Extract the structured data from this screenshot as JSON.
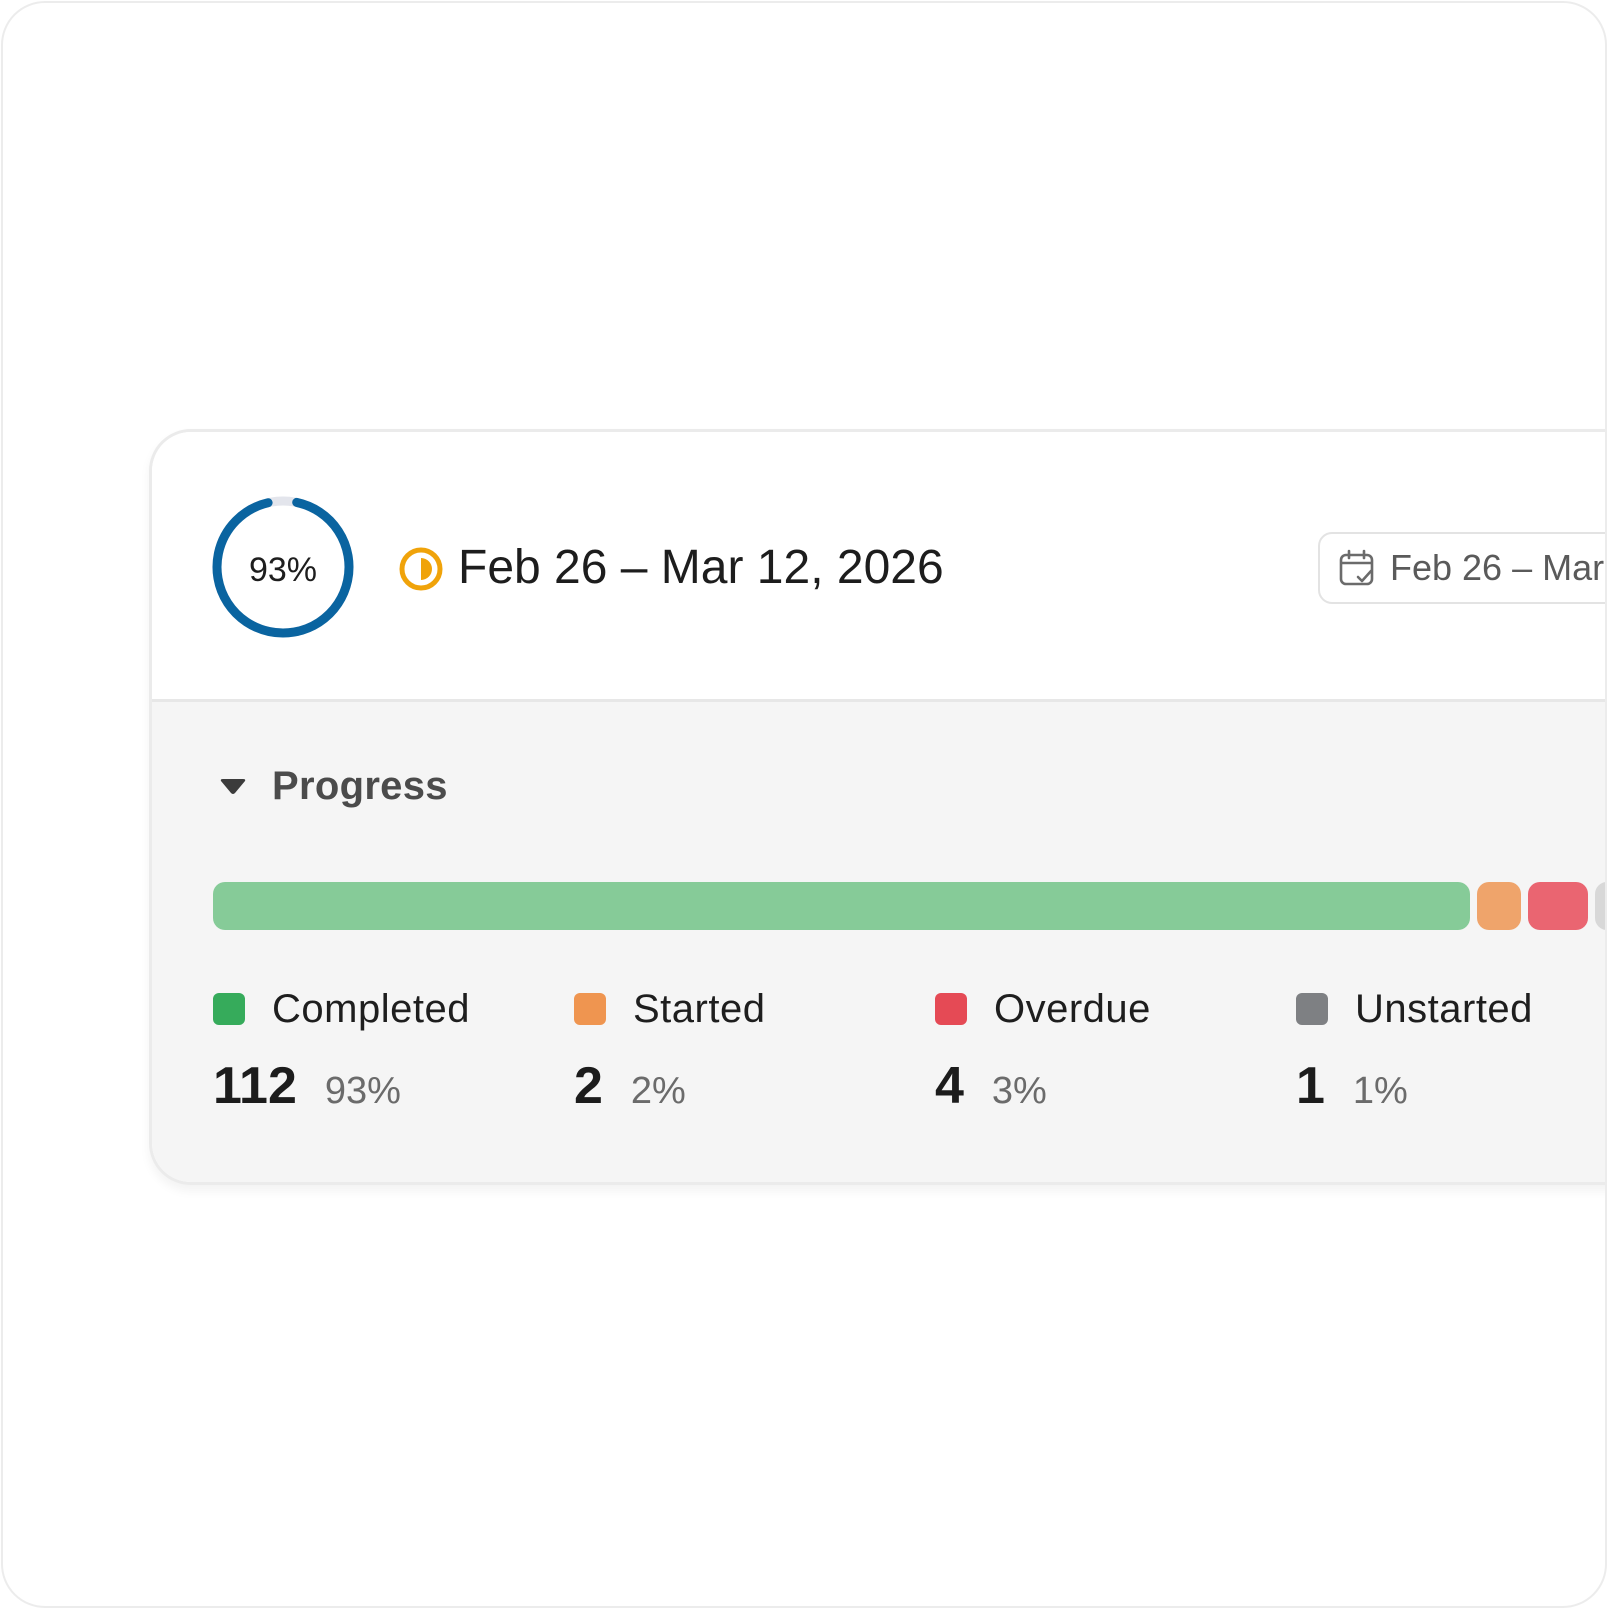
{
  "header": {
    "progress_ring": {
      "percent_label": "93%",
      "fraction": 0.93,
      "color": "#0a64a0",
      "track_color": "#e3e5ec"
    },
    "status_icon": "half-circle-status-icon",
    "status_color": "#f0a30a",
    "title": "Feb 26 – Mar 12, 2026",
    "date_button": {
      "icon": "calendar-check-icon",
      "label": "Feb 26 – Mar"
    }
  },
  "progress": {
    "section_label": "Progress",
    "toggle_icon": "caret-down-icon",
    "bar_segments": [
      {
        "name": "completed",
        "fraction": 0.93,
        "color": "#86cb98"
      },
      {
        "name": "started",
        "fraction": 0.02,
        "color": "#efa46b"
      },
      {
        "name": "overdue",
        "fraction": 0.03,
        "color": "#ea6571"
      },
      {
        "name": "unstarted",
        "fraction": 0.01,
        "color": "#d8d8d8"
      }
    ],
    "legend": [
      {
        "label": "Completed",
        "count": "112",
        "percent": "93%",
        "color": "#36ab5b"
      },
      {
        "label": "Started",
        "count": "2",
        "percent": "2%",
        "color": "#ef9550"
      },
      {
        "label": "Overdue",
        "count": "4",
        "percent": "3%",
        "color": "#e54a55"
      },
      {
        "label": "Unstarted",
        "count": "1",
        "percent": "1%",
        "color": "#7e8083"
      }
    ]
  }
}
